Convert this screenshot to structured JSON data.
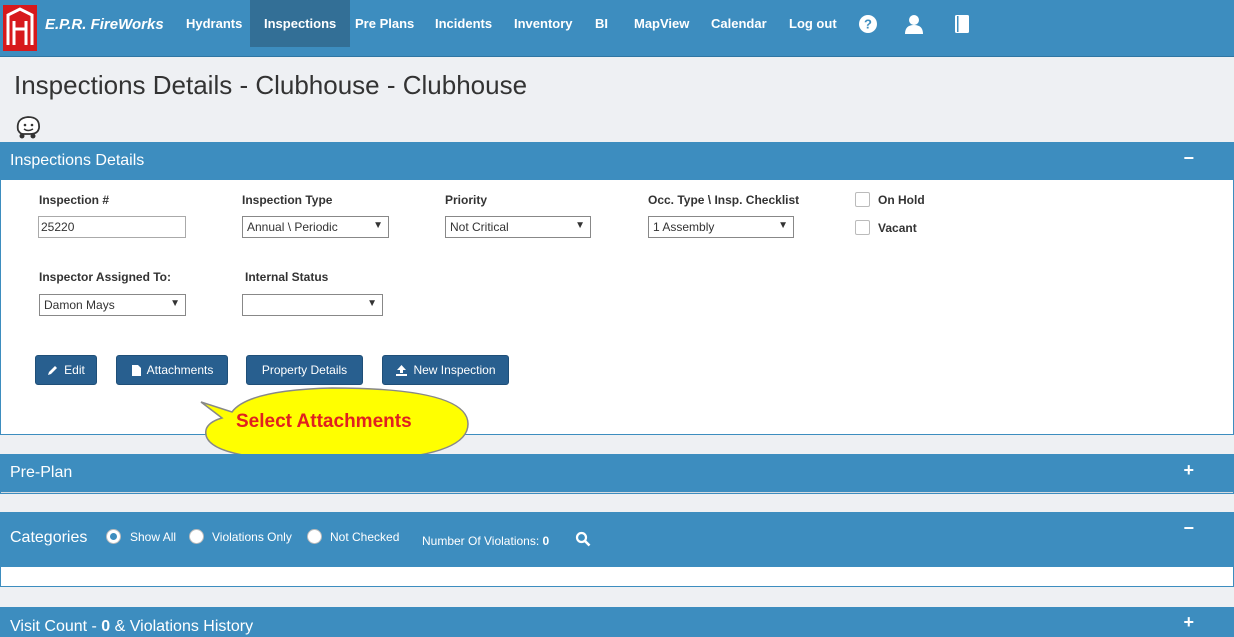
{
  "nav": {
    "brand": "E.P.R. FireWorks",
    "items": [
      {
        "label": "Hydrants",
        "active": false
      },
      {
        "label": "Inspections",
        "active": true
      },
      {
        "label": "Pre Plans",
        "active": false
      },
      {
        "label": "Incidents",
        "active": false
      },
      {
        "label": "Inventory",
        "active": false
      },
      {
        "label": "BI",
        "active": false
      },
      {
        "label": "MapView",
        "active": false
      },
      {
        "label": "Calendar",
        "active": false
      },
      {
        "label": "Log out",
        "active": false
      }
    ],
    "icons": [
      "help-icon",
      "user-icon",
      "book-icon"
    ]
  },
  "page": {
    "title": "Inspections Details - Clubhouse - Clubhouse"
  },
  "details": {
    "title": "Inspections Details",
    "toggle": "−",
    "inspection_label": "Inspection #",
    "inspection_value": "25220",
    "type_label": "Inspection Type",
    "type_value": "Annual \\ Periodic",
    "priority_label": "Priority",
    "priority_value": "Not Critical",
    "occ_label": "Occ. Type \\ Insp. Checklist",
    "occ_value": "1 Assembly",
    "on_hold_label": "On Hold",
    "vacant_label": "Vacant",
    "inspector_label": "Inspector Assigned To:",
    "inspector_value": "Damon Mays",
    "status_label": "Internal Status",
    "status_value": ""
  },
  "buttons": {
    "edit": "Edit",
    "attachments": "Attachments",
    "property": "Property Details",
    "new_inspection": "New Inspection"
  },
  "callout": {
    "text": "Select Attachments"
  },
  "preplan": {
    "title": "Pre-Plan",
    "toggle": "+"
  },
  "categories": {
    "title": "Categories",
    "toggle": "−",
    "show_all": "Show All",
    "violations_only": "Violations Only",
    "not_checked": "Not Checked",
    "violations_label": "Number Of Violations:",
    "violations_count": "0"
  },
  "visit": {
    "prefix": "Visit Count - ",
    "count": "0",
    "suffix": " & Violations History",
    "toggle": "+"
  },
  "colors": {
    "primary": "#3d8dbf",
    "button": "#285f8f",
    "callout_fill": "#ffff00",
    "callout_text": "#e02020"
  }
}
